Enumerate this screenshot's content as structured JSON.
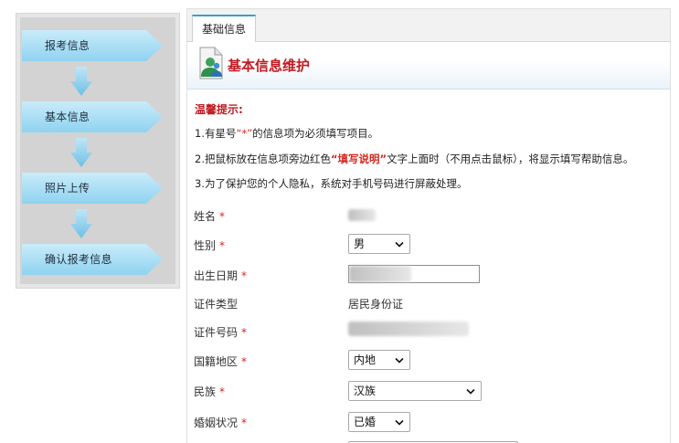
{
  "steps": [
    {
      "label": "报考信息"
    },
    {
      "label": "基本信息"
    },
    {
      "label": "照片上传"
    },
    {
      "label": "确认报考信息"
    }
  ],
  "tab": {
    "label": "基础信息"
  },
  "header": {
    "title": "基本信息维护"
  },
  "tips": {
    "title": "温馨提示:",
    "line1_a": "1.有星号",
    "line1_star": "“*”",
    "line1_b": "的信息项为必须填写项目。",
    "line2_a": "2.把鼠标放在信息项旁边红色",
    "line2_hint": "“填写说明”",
    "line2_b": "文字上面时（不用点击鼠标），将显示填写帮助信息。",
    "line3": "3.为了保护您的个人隐私，系统对手机号码进行屏蔽处理。"
  },
  "form": {
    "name": {
      "label": "姓名",
      "required": "*"
    },
    "gender": {
      "label": "性别",
      "required": "*",
      "value": "男"
    },
    "birth": {
      "label": "出生日期",
      "required": "*"
    },
    "id_type": {
      "label": "证件类型",
      "value": "居民身份证"
    },
    "id_no": {
      "label": "证件号码",
      "required": "*"
    },
    "region": {
      "label": "国籍地区",
      "required": "*",
      "value": "内地"
    },
    "ethnic": {
      "label": "民族",
      "required": "*",
      "value": "汉族"
    },
    "marital": {
      "label": "婚姻状况",
      "required": "*",
      "value": "已婚"
    }
  },
  "colors": {
    "accent_red": "#c01b22",
    "tab_blue": "#3a9bd8",
    "step_blue": "#a9def5"
  }
}
